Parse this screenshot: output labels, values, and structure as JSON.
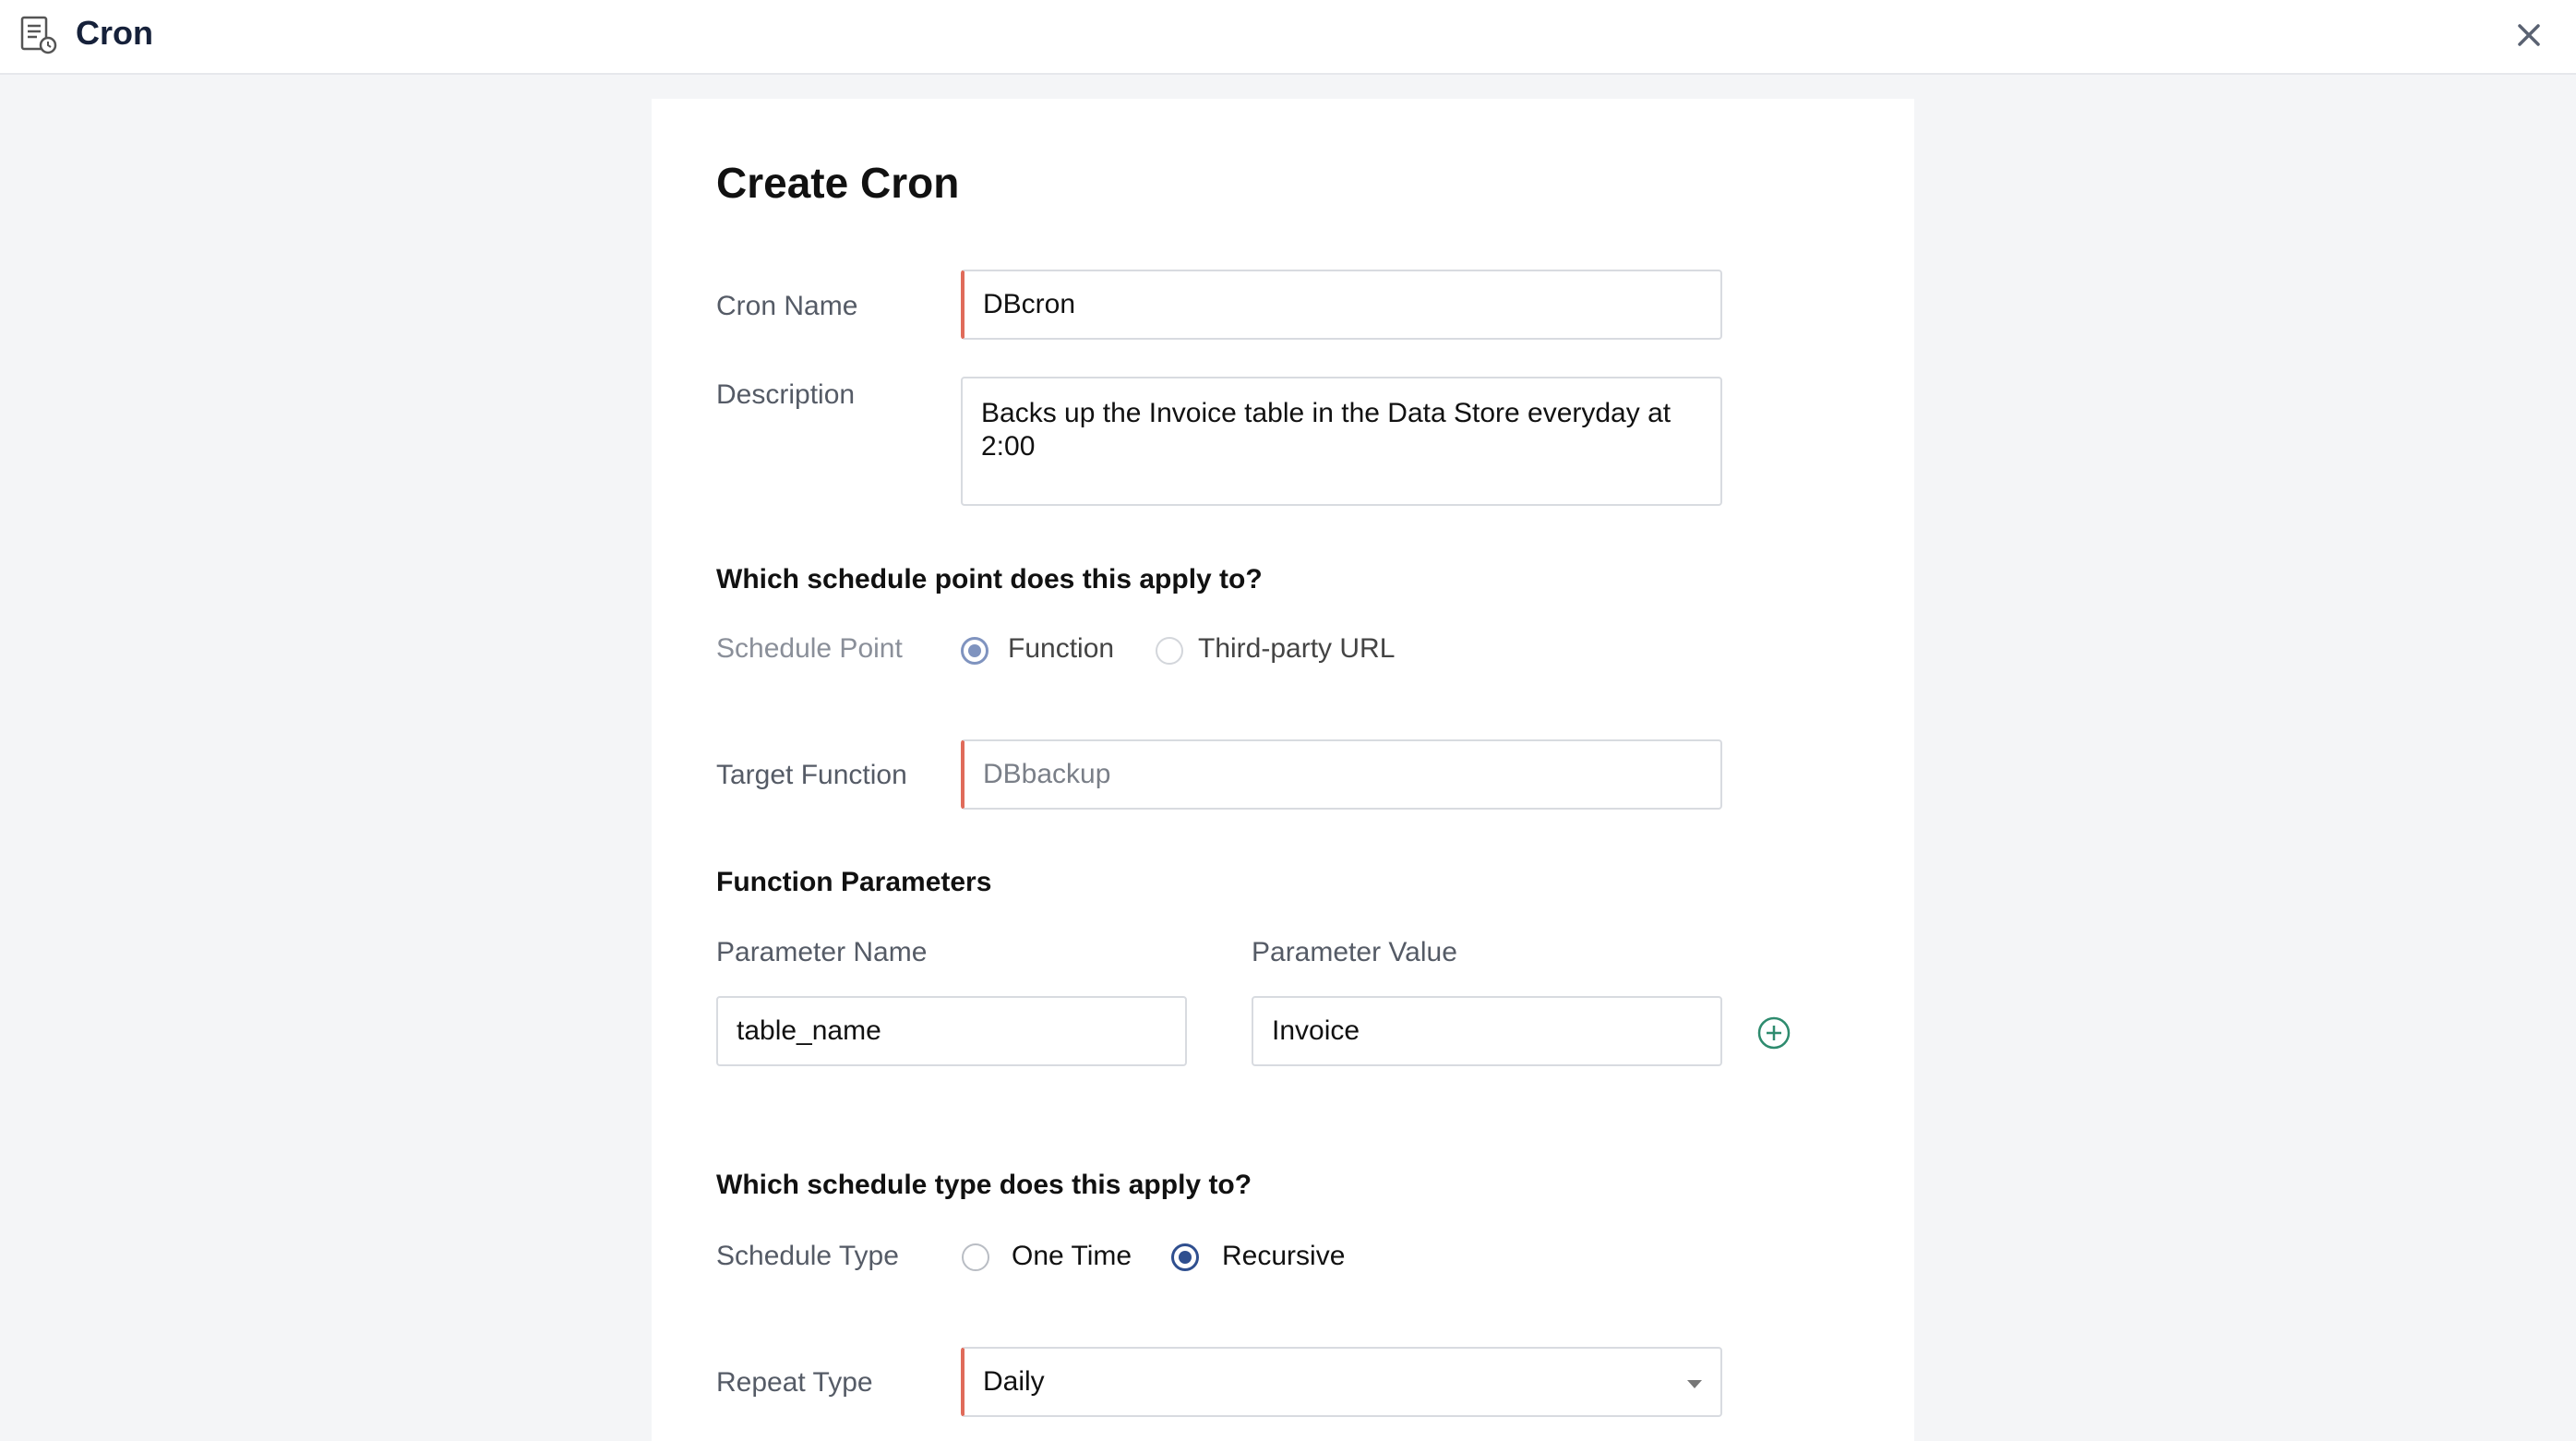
{
  "header": {
    "app_title": "Cron",
    "app_icon": "cron-document-icon",
    "close_icon": "close-icon"
  },
  "form": {
    "heading": "Create Cron",
    "cron_name": {
      "label": "Cron Name",
      "value": "DBcron"
    },
    "description": {
      "label": "Description",
      "value": "Backs up the Invoice table in the Data Store everyday at 2:00"
    },
    "schedule_point": {
      "question": "Which schedule point does this apply to?",
      "label": "Schedule Point",
      "options": [
        {
          "label": "Function",
          "selected": true
        },
        {
          "label": "Third-party URL",
          "selected": false
        }
      ]
    },
    "target_function": {
      "label": "Target Function",
      "value": "DBbackup"
    },
    "function_parameters": {
      "title": "Function Parameters",
      "name_header": "Parameter Name",
      "value_header": "Parameter Value",
      "rows": [
        {
          "name": "table_name",
          "value": "Invoice"
        }
      ],
      "add_icon": "add-circle-icon"
    },
    "schedule_type": {
      "question": "Which schedule type does this apply to?",
      "label": "Schedule Type",
      "options": [
        {
          "label": "One Time",
          "selected": false
        },
        {
          "label": "Recursive",
          "selected": true
        }
      ]
    },
    "repeat_type": {
      "label": "Repeat Type",
      "value": "Daily"
    }
  },
  "colors": {
    "required_accent": "#e06b5a",
    "radio_selected": "#2f4f8f",
    "add_icon": "#2e8b6e"
  }
}
